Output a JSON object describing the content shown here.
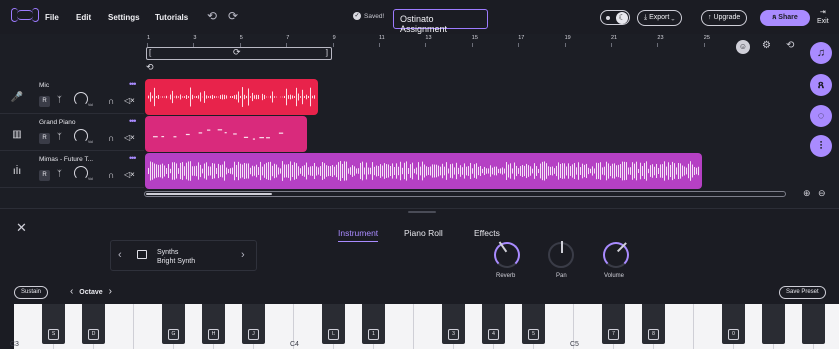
{
  "menu": {
    "file": "File",
    "edit": "Edit",
    "settings": "Settings",
    "tutorials": "Tutorials"
  },
  "status": {
    "saved": "Saved!"
  },
  "project": {
    "title": "Ostinato Assignment"
  },
  "toolbar": {
    "export": "Export",
    "upgrade": "Upgrade",
    "share": "Share",
    "exit": "Exit"
  },
  "ruler": {
    "ticks": [
      "1",
      "3",
      "5",
      "7",
      "9",
      "11",
      "13",
      "15",
      "17",
      "19",
      "21",
      "23",
      "25"
    ]
  },
  "tracks": [
    {
      "name": "Mic",
      "r": "R",
      "vol": "Vol",
      "color": "#e8234b"
    },
    {
      "name": "Grand Piano",
      "r": "R",
      "vol": "Vol",
      "color": "#d92a7c"
    },
    {
      "name": "Mimas - Future T...",
      "r": "R",
      "vol": "Vol",
      "color": "#b540c4"
    }
  ],
  "panel": {
    "tabs": [
      "Instrument",
      "Piano Roll",
      "Effects"
    ],
    "active_tab": "Instrument",
    "preset_category": "Synths",
    "preset_name": "Bright Synth",
    "knobs": {
      "reverb": "Reverb",
      "pan": "Pan",
      "volume": "Volume"
    },
    "sustain": "Sustain",
    "octave": "Octave",
    "save_preset": "Save Preset"
  },
  "piano": {
    "black_keys": [
      "S",
      "D",
      "G",
      "H",
      "J",
      "L",
      "1",
      "3",
      "4",
      "5",
      "7",
      "8",
      "0"
    ],
    "notes": [
      "C3",
      "C4",
      "C5"
    ]
  },
  "colors": {
    "accent": "#a98bff",
    "mic": "#e8234b",
    "piano": "#d92a7c",
    "mimas": "#b540c4"
  }
}
